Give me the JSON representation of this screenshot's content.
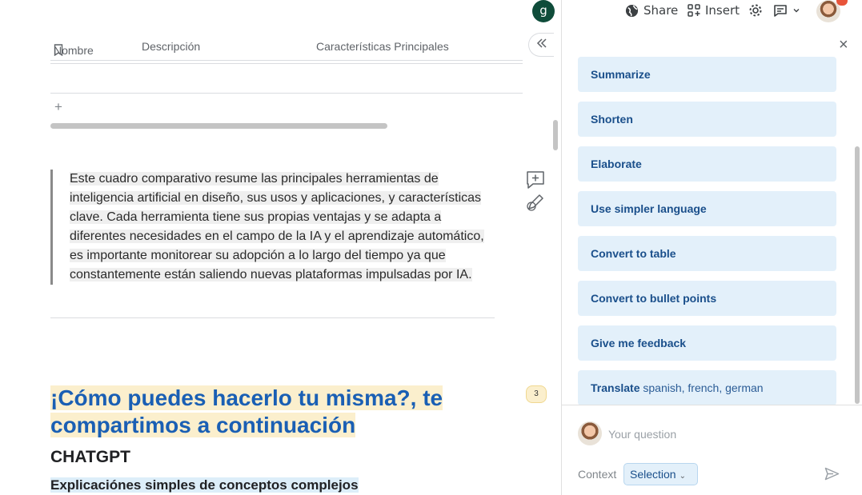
{
  "workspace": {
    "avatar_letter": "g"
  },
  "toolbar": {
    "share_label": "Share",
    "insert_label": "Insert",
    "share_icon": "globe-icon",
    "insert_icon": "grid-icon",
    "settings_icon": "gear-icon",
    "comments_icon": "comment-icon"
  },
  "table": {
    "col_name": "Nombre",
    "col_desc": "Descripción",
    "col_features": "Características Principales",
    "add_row": "+"
  },
  "quote": {
    "text": "Este cuadro comparativo resume las principales herramientas de inteligencia artificial en diseño, sus usos y aplicaciones, y características clave. Cada herramienta tiene sus propias ventajas y se adapta a diferentes necesidades en el campo de la IA y el aprendizaje automático, es importante monitorear su adopción a lo largo del tiempo ya que constantemente están saliendo nuevas plataformas impulsadas por IA."
  },
  "heading": {
    "line1": "¡Cómo puedes hacerlo tu misma?, te",
    "line2": "compartimos a continuación",
    "comment_count": "3"
  },
  "subheading": "CHATGPT",
  "subheading2": "Explicaciónes simples de conceptos complejos",
  "panel": {
    "close": "×",
    "actions": [
      {
        "label": "Summarize"
      },
      {
        "label": "Shorten"
      },
      {
        "label": "Elaborate"
      },
      {
        "label": "Use simpler language"
      },
      {
        "label": "Convert to table"
      },
      {
        "label": "Convert to bullet points"
      },
      {
        "label": "Give me feedback"
      },
      {
        "label": "Translate",
        "extra": "spanish, french, german"
      }
    ],
    "question_placeholder": "Your question",
    "context_label": "Context",
    "context_value": "Selection"
  },
  "colors": {
    "accent": "#1a5fb4",
    "chip_bg": "#e3f0fa",
    "chip_text": "#1a4f8b",
    "highlight": "#fbefcd"
  }
}
